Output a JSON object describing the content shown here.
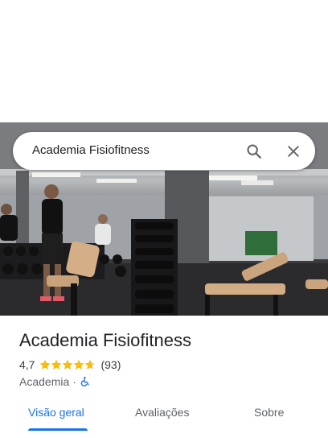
{
  "search": {
    "query": "Academia Fisiofitness"
  },
  "icons": {
    "search": "search-icon",
    "close": "close-icon",
    "accessibility": "wheelchair-icon",
    "star": "star-icon"
  },
  "place": {
    "name": "Academia Fisiofitness",
    "rating": "4,7",
    "rating_value": 4.7,
    "reviews_count": "(93)",
    "category": "Academia",
    "separator": "·"
  },
  "tabs": [
    {
      "label": "Visão geral",
      "active": true
    },
    {
      "label": "Avaliações",
      "active": false
    },
    {
      "label": "Sobre",
      "active": false
    }
  ],
  "colors": {
    "accent": "#1a73e8",
    "star": "#fbbc04",
    "star_empty": "#dadce0",
    "text": "#202124",
    "muted": "#5f6368"
  }
}
